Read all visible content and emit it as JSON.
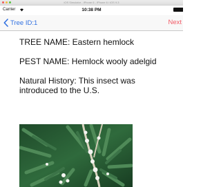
{
  "simulator": {
    "window_title": "iOS Simulator - iPhone 6 - iPhone 6 / iOS 9.3"
  },
  "status_bar": {
    "carrier": "Carrier",
    "wifi_icon": "wifi-icon",
    "time": "10:38 PM",
    "battery_icon": "battery-icon"
  },
  "nav": {
    "back_icon": "chevron-left-icon",
    "back_label": "Tree ID:1",
    "next_label": "Next",
    "tint": "#2f6fe0",
    "next_color": "#f25b66"
  },
  "content": {
    "tree_name": "TREE NAME: Eastern hemlock",
    "pest_name": "PEST NAME: Hemlock wooly adelgid",
    "natural_history": "Natural History: This insect was introduced to the U.S.",
    "image_subject": "hemlock twig with white woolly adelgid egg sacs"
  }
}
